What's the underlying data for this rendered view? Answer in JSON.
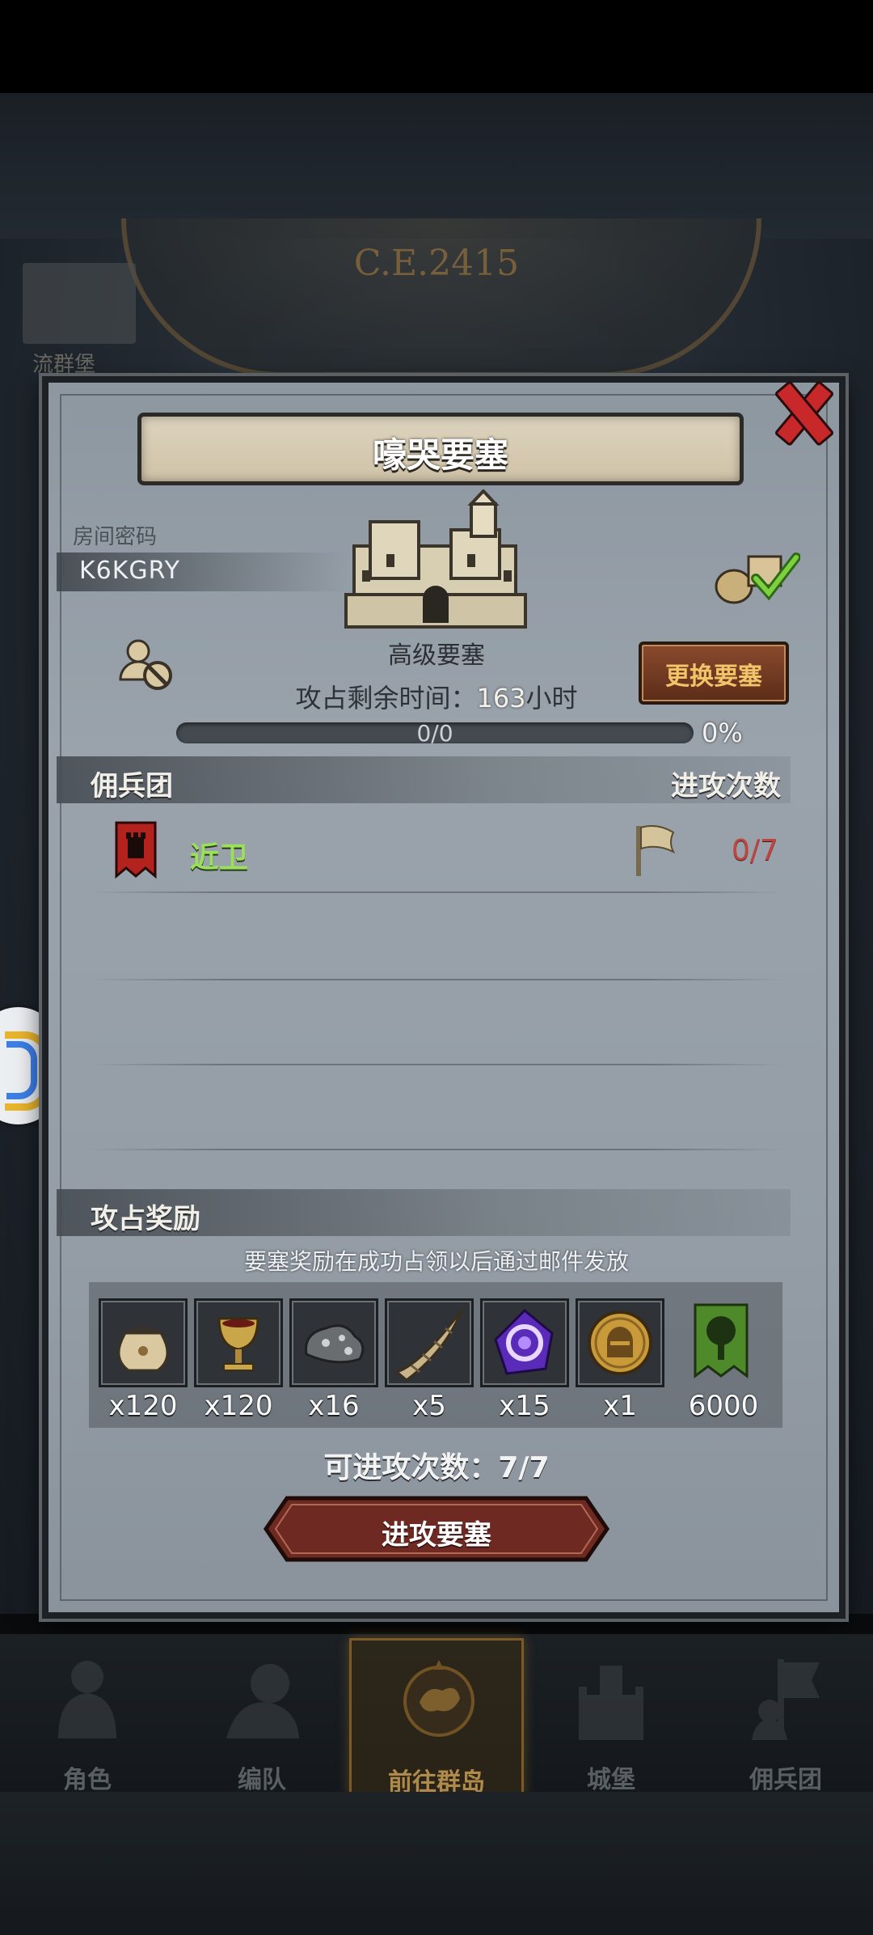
{
  "background": {
    "year_display": "C.E.2415",
    "castle_name": "流群堡"
  },
  "panel": {
    "title": "嚎哭要塞",
    "room_label": "房间密码",
    "room_code": "K6KGRY",
    "fortress_type": "高级要塞",
    "change_button": "更换要塞",
    "time_label": "攻占剩余时间：",
    "time_value": "163",
    "time_unit": "小时",
    "progress_count": "0/0",
    "progress_percent": "0%",
    "progress_value": 0
  },
  "legion_section": {
    "title": "佣兵团",
    "attack_count_header": "进攻次数",
    "rows": [
      {
        "name": "近卫",
        "attack_count": "0/7"
      }
    ]
  },
  "rewards_section": {
    "title": "攻占奖励",
    "note": "要塞奖励在成功占领以后通过邮件发放",
    "items": [
      {
        "icon": "money-bag-icon",
        "qty": "x120"
      },
      {
        "icon": "goblet-icon",
        "qty": "x120"
      },
      {
        "icon": "ore-rock-icon",
        "qty": "x16"
      },
      {
        "icon": "horn-icon",
        "qty": "x5"
      },
      {
        "icon": "purple-crystal-icon",
        "qty": "x15"
      },
      {
        "icon": "knight-coin-icon",
        "qty": "x1"
      },
      {
        "icon": "tree-banner-icon",
        "qty": "6000"
      }
    ]
  },
  "attempts": "可进攻次数：7/7",
  "attack_button": "进攻要塞",
  "bottom_nav": [
    {
      "label": "角色",
      "icon": "character-icon",
      "active": false
    },
    {
      "label": "编队",
      "icon": "formation-icon",
      "active": false
    },
    {
      "label": "前往群岛",
      "icon": "compass-map-icon",
      "active": true
    },
    {
      "label": "城堡",
      "icon": "castle-icon",
      "active": false
    },
    {
      "label": "佣兵团",
      "icon": "mercenary-icon",
      "active": false
    }
  ],
  "colors": {
    "accent_gold": "#f2c46a",
    "legion_green": "#9be05a",
    "count_red": "#c0453e",
    "close_red": "#c8282a"
  }
}
